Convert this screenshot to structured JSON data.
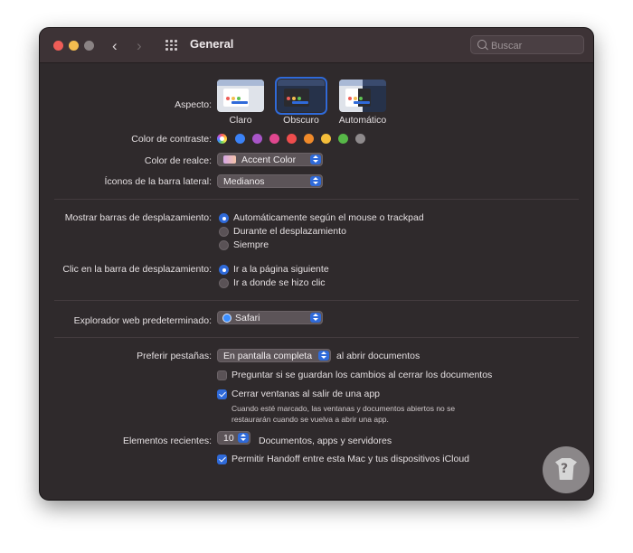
{
  "window": {
    "title": "General",
    "search_placeholder": "Buscar"
  },
  "colors": {
    "accent": "#2f6ad9",
    "window_bg": "#2f2a2c",
    "titlebar_bg": "#3d3336"
  },
  "appearance": {
    "label": "Aspecto:",
    "options": [
      {
        "label": "Claro",
        "selected": false
      },
      {
        "label": "Obscuro",
        "selected": true
      },
      {
        "label": "Automático",
        "selected": false
      }
    ]
  },
  "contrast": {
    "label": "Color de contraste:",
    "swatches": [
      "multicolor",
      "#3b82f6",
      "#a855c8",
      "#e0478f",
      "#ef4d4d",
      "#f08a2a",
      "#f5be3a",
      "#57b848",
      "#8e8a8c"
    ]
  },
  "highlight": {
    "label": "Color de realce:",
    "value": "Accent Color"
  },
  "sidebar_icons": {
    "label": "Íconos de la barra lateral:",
    "value": "Medianos"
  },
  "scrollbars": {
    "label": "Mostrar barras de desplazamiento:",
    "options": [
      {
        "label": "Automáticamente según el mouse o trackpad",
        "selected": true
      },
      {
        "label": "Durante el desplazamiento",
        "selected": false
      },
      {
        "label": "Siempre",
        "selected": false
      }
    ]
  },
  "scroll_click": {
    "label": "Clic en la barra de desplazamiento:",
    "options": [
      {
        "label": "Ir a la página siguiente",
        "selected": true
      },
      {
        "label": "Ir a donde se hizo clic",
        "selected": false
      }
    ]
  },
  "browser": {
    "label": "Explorador web predeterminado:",
    "value": "Safari"
  },
  "tabs": {
    "label": "Preferir pestañas:",
    "value": "En pantalla completa",
    "suffix": "al abrir documentos"
  },
  "ask_save": {
    "label": "Preguntar si se guardan los cambios al cerrar los documentos",
    "checked": false
  },
  "close_windows": {
    "label": "Cerrar ventanas al salir de una app",
    "checked": true,
    "note_line1": "Cuando esté marcado, las ventanas y documentos abiertos no se",
    "note_line2": "restaurarán cuando se vuelva a abrir una app."
  },
  "recent": {
    "label": "Elementos recientes:",
    "value": "10",
    "suffix": "Documentos, apps y servidores"
  },
  "handoff": {
    "label": "Permitir Handoff entre esta Mac y tus dispositivos iCloud",
    "checked": true
  }
}
